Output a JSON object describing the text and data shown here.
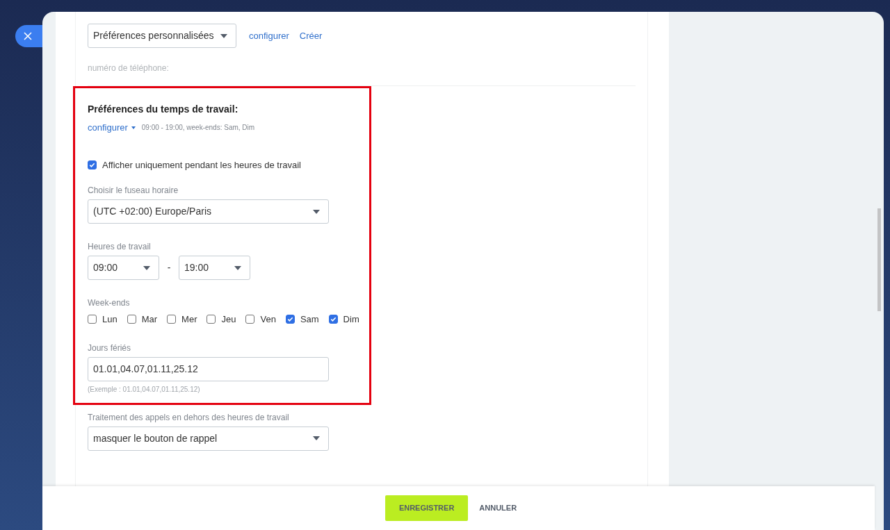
{
  "profile_select": {
    "value": "Préférences personnalisées"
  },
  "profile_links": [
    "configurer",
    "Créer"
  ],
  "phone_label": "numéro de téléphone:",
  "work_time": {
    "title": "Préférences du temps de travail:",
    "configure_link": "configurer",
    "summary": "09:00 - 19:00, week-ends: Sam, Dim",
    "only_work_hours": {
      "label": "Afficher uniquement pendant les heures de travail",
      "checked": true
    },
    "timezone": {
      "label": "Choisir le fuseau horaire",
      "value": "(UTC +02:00) Europe/Paris"
    },
    "hours": {
      "label": "Heures de travail",
      "from": "09:00",
      "separator": "-",
      "to": "19:00"
    },
    "weekends": {
      "label": "Week-ends",
      "days": [
        {
          "label": "Lun",
          "checked": false
        },
        {
          "label": "Mar",
          "checked": false
        },
        {
          "label": "Mer",
          "checked": false
        },
        {
          "label": "Jeu",
          "checked": false
        },
        {
          "label": "Ven",
          "checked": false
        },
        {
          "label": "Sam",
          "checked": true
        },
        {
          "label": "Dim",
          "checked": true
        }
      ]
    },
    "holidays": {
      "label": "Jours fériés",
      "value": "01.01,04.07,01.11,25.12",
      "hint": "(Exemple : 01.01,04.07,01.11,25.12)"
    }
  },
  "after_hours": {
    "label": "Traitement des appels en dehors des heures de travail",
    "value": "masquer le bouton de rappel"
  },
  "footer": {
    "save": "ENREGISTRER",
    "cancel": "ANNULER"
  }
}
